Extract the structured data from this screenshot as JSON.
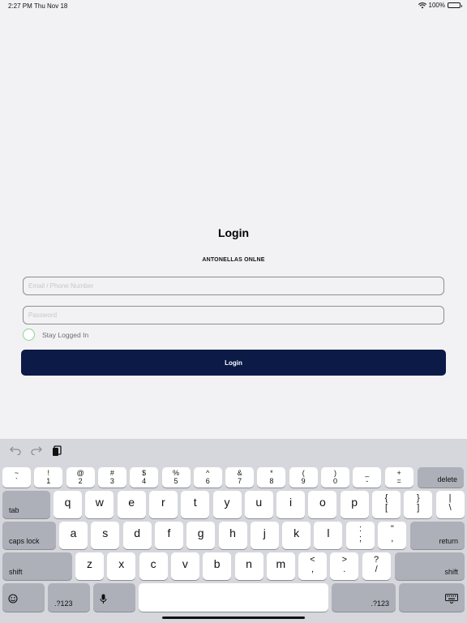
{
  "status_bar": {
    "time": "2:27 PM",
    "date": "Thu Nov 18",
    "battery": "100%",
    "wifi_icon": "wifi-icon",
    "battery_level": 1.0
  },
  "login": {
    "title": "Login",
    "brand": "ANTONELLAS ONLNE",
    "email_placeholder": "Email / Phone Number",
    "password_placeholder": "Password",
    "stay_logged_in": "Stay Logged In",
    "button_label": "Login",
    "accent_color": "#0b1a47",
    "radio_color": "#8fd18f"
  },
  "keyboard": {
    "toolbar": {
      "undo_icon": "undo-icon",
      "redo_icon": "redo-icon",
      "paste_icon": "paste-icon"
    },
    "number_row": [
      {
        "top": "~",
        "bottom": "`"
      },
      {
        "top": "!",
        "bottom": "1"
      },
      {
        "top": "@",
        "bottom": "2"
      },
      {
        "top": "#",
        "bottom": "3"
      },
      {
        "top": "$",
        "bottom": "4"
      },
      {
        "top": "%",
        "bottom": "5"
      },
      {
        "top": "^",
        "bottom": "6"
      },
      {
        "top": "&",
        "bottom": "7"
      },
      {
        "top": "*",
        "bottom": "8"
      },
      {
        "top": "(",
        "bottom": "9"
      },
      {
        "top": ")",
        "bottom": "0"
      },
      {
        "top": "_",
        "bottom": "-"
      },
      {
        "top": "+",
        "bottom": "="
      }
    ],
    "delete": "delete",
    "tab": "tab",
    "row1": [
      "q",
      "w",
      "e",
      "r",
      "t",
      "y",
      "u",
      "i",
      "o",
      "p"
    ],
    "row1_extra": [
      {
        "top": "{",
        "bottom": "["
      },
      {
        "top": "}",
        "bottom": "]"
      },
      {
        "top": "|",
        "bottom": "\\"
      }
    ],
    "caps_lock": "caps lock",
    "row2": [
      "a",
      "s",
      "d",
      "f",
      "g",
      "h",
      "j",
      "k",
      "l"
    ],
    "row2_extra": [
      {
        "top": ":",
        "bottom": ";"
      },
      {
        "top": "\"",
        "bottom": ","
      }
    ],
    "return": "return",
    "shift": "shift",
    "row3": [
      "z",
      "x",
      "c",
      "v",
      "b",
      "n",
      "m"
    ],
    "row3_extra": [
      {
        "top": "<",
        "bottom": ","
      },
      {
        "top": ">",
        "bottom": "."
      },
      {
        "top": "?",
        "bottom": "/"
      }
    ],
    "numbers_label": ".?123",
    "emoji_icon": "emoji-icon",
    "mic_icon": "microphone-icon",
    "dismiss_icon": "keyboard-dismiss-icon"
  }
}
